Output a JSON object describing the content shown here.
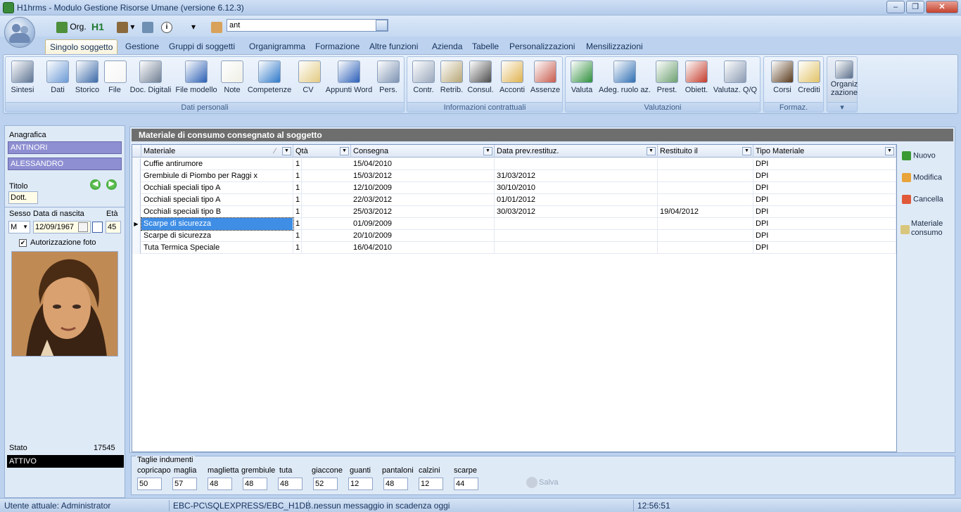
{
  "window": {
    "title": "H1hrms - Modulo Gestione Risorse Umane (versione 6.12.3)",
    "min": "–",
    "max": "❐",
    "close": "✕"
  },
  "quickaccess": {
    "org_label": "Org.",
    "h1_label": "H1",
    "search_value": "ant"
  },
  "tabs": [
    {
      "label": "Singolo soggetto"
    },
    {
      "label": "Gestione"
    },
    {
      "label": "Gruppi di soggetti"
    },
    {
      "label": "Organigramma"
    },
    {
      "label": "Formazione"
    },
    {
      "label": "Altre funzioni"
    },
    {
      "label": "Azienda"
    },
    {
      "label": "Tabelle"
    },
    {
      "label": "Personalizzazioni"
    },
    {
      "label": "Mensilizzazioni"
    }
  ],
  "ribbon": {
    "groups": [
      {
        "label": "Dati personali"
      },
      {
        "label": "Informazioni contrattuali"
      },
      {
        "label": "Valutazioni"
      },
      {
        "label": "Formaz."
      }
    ],
    "buttons": [
      {
        "label": "Sintesi",
        "icon": "list-icon",
        "color": "#5d7392"
      },
      {
        "label": "Dati",
        "icon": "id-card-icon",
        "color": "#6c9ad6"
      },
      {
        "label": "Storico",
        "icon": "person-clock-icon",
        "color": "#3b6aa8"
      },
      {
        "label": "File",
        "icon": "file-icon",
        "color": "#f5f5f5"
      },
      {
        "label": "Doc. Digitali",
        "icon": "scanner-icon",
        "color": "#6f7e92"
      },
      {
        "label": "File modello",
        "icon": "word-doc-icon",
        "color": "#2b5fb4"
      },
      {
        "label": "Note",
        "icon": "note-icon",
        "color": "#efefe6"
      },
      {
        "label": "Competenze",
        "icon": "puzzle-icon",
        "color": "#2e79c9"
      },
      {
        "label": "CV",
        "icon": "scroll-icon",
        "color": "#e3cb83"
      },
      {
        "label": "Appunti Word",
        "icon": "word-icon",
        "color": "#2a5eb8"
      },
      {
        "label": "Pers.",
        "icon": "grid-check-icon",
        "color": "#7d93b2"
      },
      {
        "label": "Contr.",
        "icon": "contract-icon",
        "color": "#9aa8bc"
      },
      {
        "label": "Retrib.",
        "icon": "money-icon",
        "color": "#b6a676"
      },
      {
        "label": "Consul.",
        "icon": "consultant-icon",
        "color": "#4c4c4c"
      },
      {
        "label": "Acconti",
        "icon": "envelope-icon",
        "color": "#e0b24f"
      },
      {
        "label": "Assenze",
        "icon": "calendar-clock-icon",
        "color": "#c85b4d"
      },
      {
        "label": "Valuta",
        "icon": "people-icon",
        "color": "#2f8f3c"
      },
      {
        "label": "Adeg. ruolo az.",
        "icon": "person-check-icon",
        "color": "#2f6fb3"
      },
      {
        "label": "Prest.",
        "icon": "chart-line-icon",
        "color": "#6da070"
      },
      {
        "label": "Obiett.",
        "icon": "target-icon",
        "color": "#c43b2b"
      },
      {
        "label": "Valutaz. Q/Q",
        "icon": "table-icon",
        "color": "#8a9ab2"
      },
      {
        "label": "Corsi",
        "icon": "blackboard-icon",
        "color": "#5a3a1c"
      },
      {
        "label": "Crediti",
        "icon": "certificate-icon",
        "color": "#e2c367"
      },
      {
        "label": "Organiz\nzazione",
        "icon": "org-person-icon",
        "color": "#5b6f8a"
      }
    ]
  },
  "person": {
    "anagrafica_label": "Anagrafica",
    "surname": "ANTINORI",
    "firstname": "ALESSANDRO",
    "titolo_label": "Titolo",
    "titolo": "Dott.",
    "sesso_label": "Sesso",
    "nascita_label": "Data di nascita",
    "eta_label": "Età",
    "sesso": "M",
    "nascita": "12/09/1967",
    "eta": "45",
    "autorizzazione_label": "Autorizzazione foto",
    "stato_label": "Stato",
    "stato_code": "17545",
    "stato": "ATTIVO"
  },
  "panel": {
    "title": "Materiale di consumo consegnato al soggetto",
    "columns": [
      "Materiale",
      "Qtà",
      "Consegna",
      "Data prev.restituz.",
      "Restituito il",
      "Tipo Materiale"
    ],
    "rows": [
      {
        "materiale": "Cuffie antirumore",
        "qta": "1",
        "consegna": "15/04/2010",
        "prev": "",
        "restituito": "",
        "tipo": "DPI"
      },
      {
        "materiale": "Grembiule di Piombo per Raggi x",
        "qta": "1",
        "consegna": "15/03/2012",
        "prev": "31/03/2012",
        "restituito": "",
        "tipo": "DPI"
      },
      {
        "materiale": "Occhiali speciali tipo A",
        "qta": "1",
        "consegna": "12/10/2009",
        "prev": "30/10/2010",
        "restituito": "",
        "tipo": "DPI"
      },
      {
        "materiale": "Occhiali speciali tipo A",
        "qta": "1",
        "consegna": "22/03/2012",
        "prev": "01/01/2012",
        "restituito": "",
        "tipo": "DPI"
      },
      {
        "materiale": "Occhiali speciali tipo B",
        "qta": "1",
        "consegna": "25/03/2012",
        "prev": "30/03/2012",
        "restituito": "19/04/2012",
        "tipo": "DPI"
      },
      {
        "materiale": "Scarpe di sicurezza",
        "qta": "1",
        "consegna": "01/09/2009",
        "prev": "",
        "restituito": "",
        "tipo": "DPI"
      },
      {
        "materiale": "Scarpe di sicurezza",
        "qta": "1",
        "consegna": "20/10/2009",
        "prev": "",
        "restituito": "",
        "tipo": "DPI"
      },
      {
        "materiale": "Tuta Termica Speciale",
        "qta": "1",
        "consegna": "16/04/2010",
        "prev": "",
        "restituito": "",
        "tipo": "DPI"
      }
    ],
    "actions": {
      "nuovo": "Nuovo",
      "modifica": "Modifica",
      "cancella": "Cancella",
      "materiale_consumo_1": "Materiale",
      "materiale_consumo_2": "consumo"
    }
  },
  "sizes": {
    "legend": "Taglie indumenti",
    "items": [
      {
        "label": "copricapo",
        "value": "50"
      },
      {
        "label": "maglia",
        "value": "57"
      },
      {
        "label": "maglietta",
        "value": "48"
      },
      {
        "label": "grembiule",
        "value": "48"
      },
      {
        "label": "tuta",
        "value": "48"
      },
      {
        "label": "giaccone",
        "value": "52"
      },
      {
        "label": "guanti",
        "value": "12"
      },
      {
        "label": "pantaloni",
        "value": "48"
      },
      {
        "label": "calzini",
        "value": "12"
      },
      {
        "label": "scarpe",
        "value": "44"
      }
    ],
    "salva": "Salva"
  },
  "statusbar": {
    "user": "Utente attuale: Administrator",
    "db": "EBC-PC\\SQLEXPRESS/EBC_H1DB...",
    "msg": "nessun messaggio in scadenza oggi",
    "time": "12:56:51"
  }
}
